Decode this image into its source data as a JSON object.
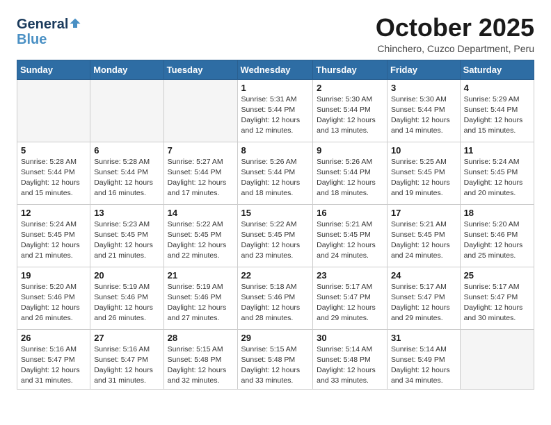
{
  "logo": {
    "line1": "General",
    "line2": "Blue"
  },
  "header": {
    "title": "October 2025",
    "location": "Chinchero, Cuzco Department, Peru"
  },
  "weekdays": [
    "Sunday",
    "Monday",
    "Tuesday",
    "Wednesday",
    "Thursday",
    "Friday",
    "Saturday"
  ],
  "weeks": [
    [
      {
        "day": "",
        "info": ""
      },
      {
        "day": "",
        "info": ""
      },
      {
        "day": "",
        "info": ""
      },
      {
        "day": "1",
        "info": "Sunrise: 5:31 AM\nSunset: 5:44 PM\nDaylight: 12 hours\nand 12 minutes."
      },
      {
        "day": "2",
        "info": "Sunrise: 5:30 AM\nSunset: 5:44 PM\nDaylight: 12 hours\nand 13 minutes."
      },
      {
        "day": "3",
        "info": "Sunrise: 5:30 AM\nSunset: 5:44 PM\nDaylight: 12 hours\nand 14 minutes."
      },
      {
        "day": "4",
        "info": "Sunrise: 5:29 AM\nSunset: 5:44 PM\nDaylight: 12 hours\nand 15 minutes."
      }
    ],
    [
      {
        "day": "5",
        "info": "Sunrise: 5:28 AM\nSunset: 5:44 PM\nDaylight: 12 hours\nand 15 minutes."
      },
      {
        "day": "6",
        "info": "Sunrise: 5:28 AM\nSunset: 5:44 PM\nDaylight: 12 hours\nand 16 minutes."
      },
      {
        "day": "7",
        "info": "Sunrise: 5:27 AM\nSunset: 5:44 PM\nDaylight: 12 hours\nand 17 minutes."
      },
      {
        "day": "8",
        "info": "Sunrise: 5:26 AM\nSunset: 5:44 PM\nDaylight: 12 hours\nand 18 minutes."
      },
      {
        "day": "9",
        "info": "Sunrise: 5:26 AM\nSunset: 5:44 PM\nDaylight: 12 hours\nand 18 minutes."
      },
      {
        "day": "10",
        "info": "Sunrise: 5:25 AM\nSunset: 5:45 PM\nDaylight: 12 hours\nand 19 minutes."
      },
      {
        "day": "11",
        "info": "Sunrise: 5:24 AM\nSunset: 5:45 PM\nDaylight: 12 hours\nand 20 minutes."
      }
    ],
    [
      {
        "day": "12",
        "info": "Sunrise: 5:24 AM\nSunset: 5:45 PM\nDaylight: 12 hours\nand 21 minutes."
      },
      {
        "day": "13",
        "info": "Sunrise: 5:23 AM\nSunset: 5:45 PM\nDaylight: 12 hours\nand 21 minutes."
      },
      {
        "day": "14",
        "info": "Sunrise: 5:22 AM\nSunset: 5:45 PM\nDaylight: 12 hours\nand 22 minutes."
      },
      {
        "day": "15",
        "info": "Sunrise: 5:22 AM\nSunset: 5:45 PM\nDaylight: 12 hours\nand 23 minutes."
      },
      {
        "day": "16",
        "info": "Sunrise: 5:21 AM\nSunset: 5:45 PM\nDaylight: 12 hours\nand 24 minutes."
      },
      {
        "day": "17",
        "info": "Sunrise: 5:21 AM\nSunset: 5:45 PM\nDaylight: 12 hours\nand 24 minutes."
      },
      {
        "day": "18",
        "info": "Sunrise: 5:20 AM\nSunset: 5:46 PM\nDaylight: 12 hours\nand 25 minutes."
      }
    ],
    [
      {
        "day": "19",
        "info": "Sunrise: 5:20 AM\nSunset: 5:46 PM\nDaylight: 12 hours\nand 26 minutes."
      },
      {
        "day": "20",
        "info": "Sunrise: 5:19 AM\nSunset: 5:46 PM\nDaylight: 12 hours\nand 26 minutes."
      },
      {
        "day": "21",
        "info": "Sunrise: 5:19 AM\nSunset: 5:46 PM\nDaylight: 12 hours\nand 27 minutes."
      },
      {
        "day": "22",
        "info": "Sunrise: 5:18 AM\nSunset: 5:46 PM\nDaylight: 12 hours\nand 28 minutes."
      },
      {
        "day": "23",
        "info": "Sunrise: 5:17 AM\nSunset: 5:47 PM\nDaylight: 12 hours\nand 29 minutes."
      },
      {
        "day": "24",
        "info": "Sunrise: 5:17 AM\nSunset: 5:47 PM\nDaylight: 12 hours\nand 29 minutes."
      },
      {
        "day": "25",
        "info": "Sunrise: 5:17 AM\nSunset: 5:47 PM\nDaylight: 12 hours\nand 30 minutes."
      }
    ],
    [
      {
        "day": "26",
        "info": "Sunrise: 5:16 AM\nSunset: 5:47 PM\nDaylight: 12 hours\nand 31 minutes."
      },
      {
        "day": "27",
        "info": "Sunrise: 5:16 AM\nSunset: 5:47 PM\nDaylight: 12 hours\nand 31 minutes."
      },
      {
        "day": "28",
        "info": "Sunrise: 5:15 AM\nSunset: 5:48 PM\nDaylight: 12 hours\nand 32 minutes."
      },
      {
        "day": "29",
        "info": "Sunrise: 5:15 AM\nSunset: 5:48 PM\nDaylight: 12 hours\nand 33 minutes."
      },
      {
        "day": "30",
        "info": "Sunrise: 5:14 AM\nSunset: 5:48 PM\nDaylight: 12 hours\nand 33 minutes."
      },
      {
        "day": "31",
        "info": "Sunrise: 5:14 AM\nSunset: 5:49 PM\nDaylight: 12 hours\nand 34 minutes."
      },
      {
        "day": "",
        "info": ""
      }
    ]
  ]
}
